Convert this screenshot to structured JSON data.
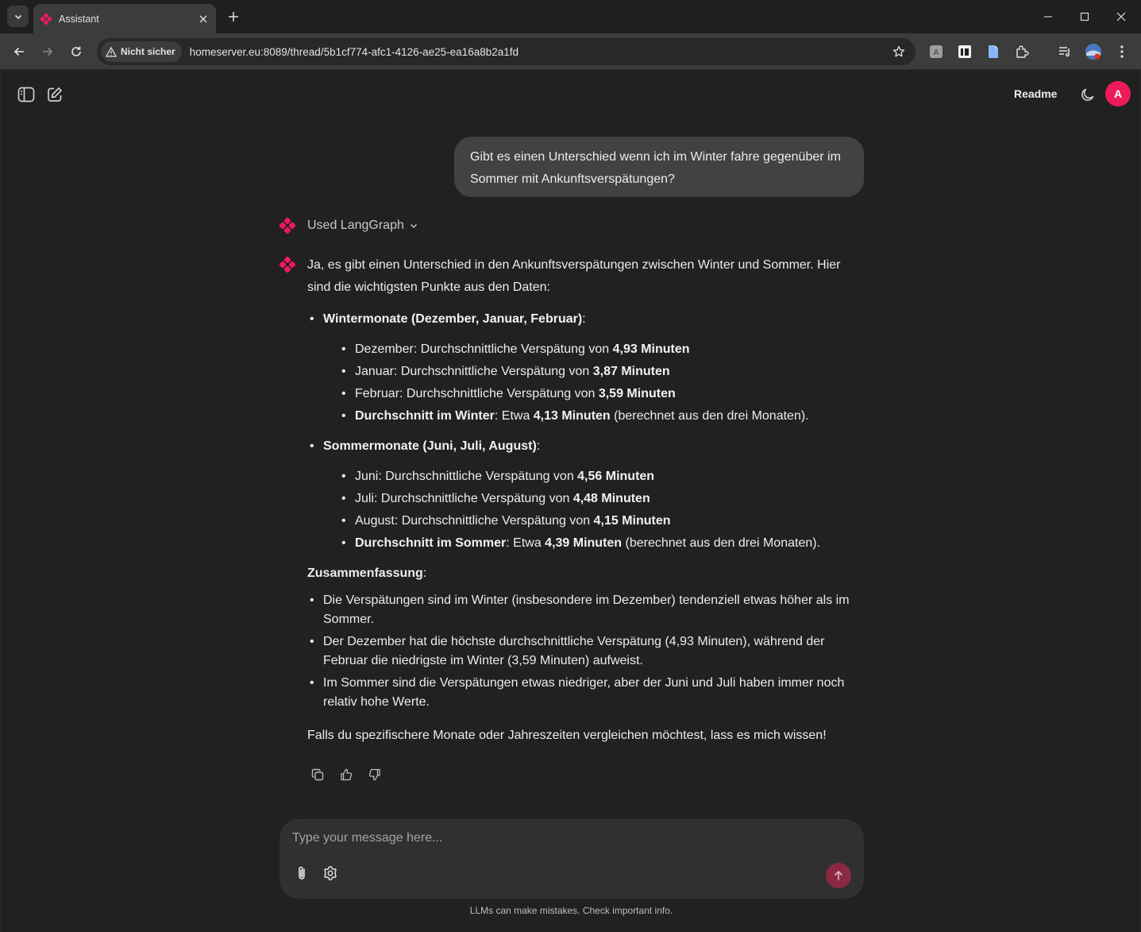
{
  "browser": {
    "tab_title": "Assistant",
    "security_label": "Nicht sicher",
    "url": "homeserver.eu:8089/thread/5b1cf774-afc1-4126-ae25-ea16a8b2a1fd"
  },
  "header": {
    "readme_label": "Readme",
    "avatar_initial": "A"
  },
  "user_message": "Gibt es einen Unterschied wenn ich im Winter fahre gegenüber im Sommer mit Ankunftsverspätungen?",
  "tool_used_label": "Used LangGraph",
  "answer": {
    "intro": "Ja, es gibt einen Unterschied in den Ankunftsverspätungen zwischen Winter und Sommer. Hier sind die wichtigsten Punkte aus den Daten:",
    "winter": {
      "title": "Wintermonate (Dezember, Januar, Februar)",
      "items": [
        {
          "prefix": "Dezember: Durchschnittliche Verspätung von ",
          "value": "4,93 Minuten"
        },
        {
          "prefix": "Januar: Durchschnittliche Verspätung von ",
          "value": "3,87 Minuten"
        },
        {
          "prefix": "Februar: Durchschnittliche Verspätung von ",
          "value": "3,59 Minuten"
        }
      ],
      "avg_label": "Durchschnitt im Winter",
      "avg_mid": ": Etwa ",
      "avg_value": "4,13 Minuten",
      "avg_suffix": " (berechnet aus den drei Monaten)."
    },
    "summer": {
      "title": "Sommermonate (Juni, Juli, August)",
      "items": [
        {
          "prefix": "Juni: Durchschnittliche Verspätung von ",
          "value": "4,56 Minuten"
        },
        {
          "prefix": "Juli: Durchschnittliche Verspätung von ",
          "value": "4,48 Minuten"
        },
        {
          "prefix": "August: Durchschnittliche Verspätung von ",
          "value": "4,15 Minuten"
        }
      ],
      "avg_label": "Durchschnitt im Sommer",
      "avg_mid": ": Etwa ",
      "avg_value": "4,39 Minuten",
      "avg_suffix": " (berechnet aus den drei Monaten)."
    },
    "summary_title": "Zusammenfassung",
    "summary_items": [
      "Die Verspätungen sind im Winter (insbesondere im Dezember) tendenziell etwas höher als im Sommer.",
      "Der Dezember hat die höchste durchschnittliche Verspätung (4,93 Minuten), während der Februar die niedrigste im Winter (3,59 Minuten) aufweist.",
      "Im Sommer sind die Verspätungen etwas niedriger, aber der Juni und Juli haben immer noch relativ hohe Werte."
    ],
    "closing": "Falls du spezifischere Monate oder Jahreszeiten vergleichen möchtest, lass es mich wissen!"
  },
  "composer": {
    "placeholder": "Type your message here..."
  },
  "disclaimer": "LLMs can make mistakes. Check important info.",
  "colors": {
    "accent": "#ee1b5a",
    "send_button": "#8a2a42",
    "background": "#212121",
    "bubble": "#424242"
  }
}
